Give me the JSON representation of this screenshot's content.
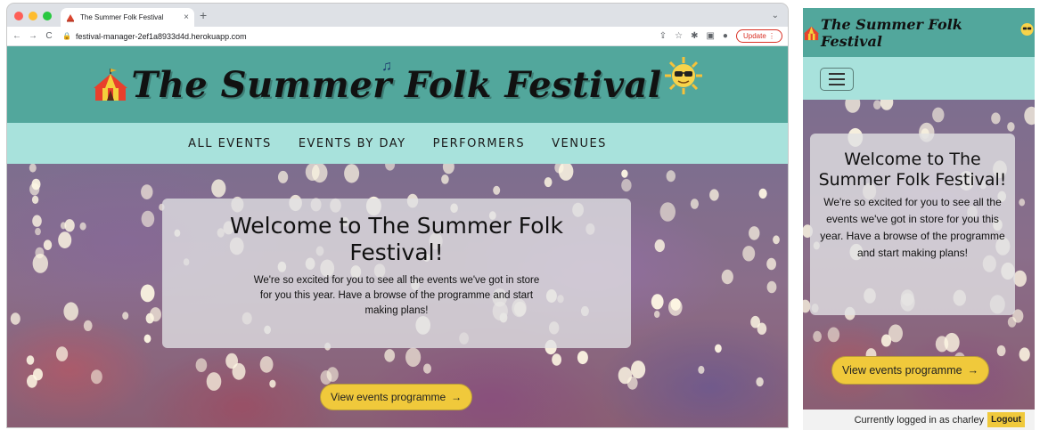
{
  "browser": {
    "tab_title": "The Summer Folk Festival",
    "tab_close": "×",
    "new_tab": "+",
    "tab_menu": "⌄",
    "url": "festival-manager-2ef1a8933d4d.herokuapp.com",
    "update_label": "Update",
    "back_icon": "←",
    "forward_icon": "→",
    "reload_icon": "C",
    "lock_icon": "🔒",
    "share_icon": "⇪",
    "star_icon": "☆",
    "ext_icon": "✱",
    "sidepanel_icon": "▣",
    "profile_icon": "●"
  },
  "site": {
    "title": "The Summer Folk Festival",
    "note_glyph": "♫",
    "nav": [
      "ALL EVENTS",
      "EVENTS BY DAY",
      "PERFORMERS",
      "VENUES"
    ],
    "hero": {
      "heading": "Welcome to The Summer Folk Festival!",
      "text": "We're so excited for you to see all the events we've got in store for you this year. Have a browse of the programme and start making plans!",
      "cta_label": "View events programme",
      "cta_arrow": "→"
    },
    "footer": {
      "logged_in_text": "Currently logged in as charley",
      "logout_label": "Logout"
    }
  },
  "colors": {
    "header": "#52a79c",
    "nav": "#a8e2dc",
    "button": "#f0c93b"
  }
}
